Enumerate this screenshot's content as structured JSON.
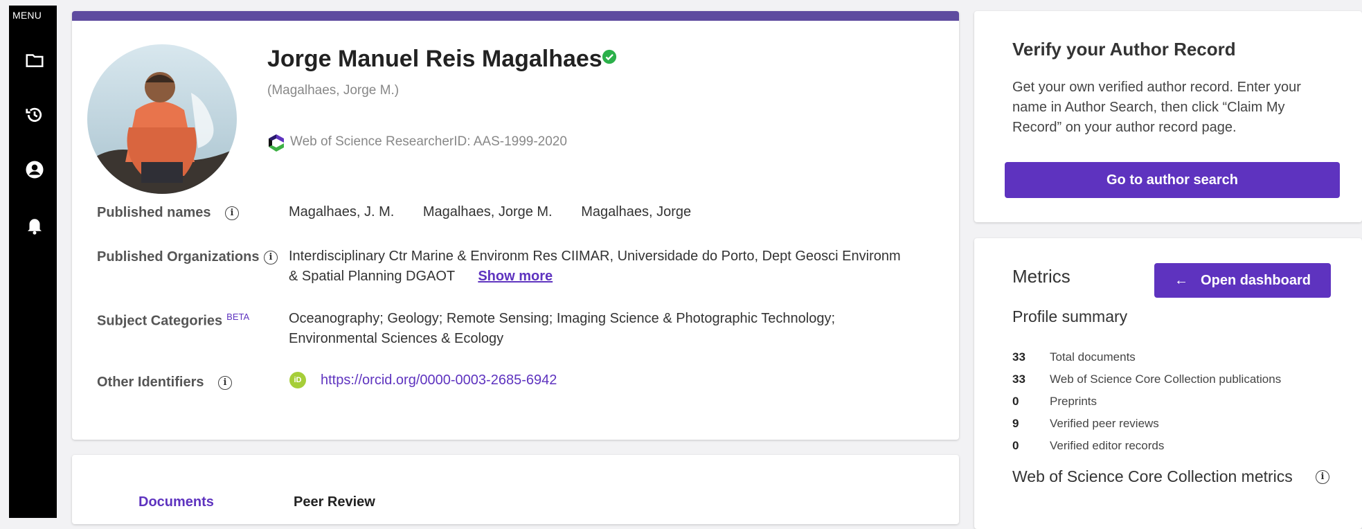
{
  "sidebar": {
    "menu_label": "MENU",
    "items": [
      {
        "icon": "folder-icon"
      },
      {
        "icon": "history-icon"
      },
      {
        "icon": "account-icon"
      },
      {
        "icon": "bell-icon"
      }
    ]
  },
  "profile": {
    "name": "Jorge Manuel Reis Magalhaes",
    "alt_name": "(Magalhaes, Jorge M.)",
    "researcher_id": "Web of Science ResearcherID: AAS-1999-2020",
    "published_names_label": "Published names",
    "published_names": [
      "Magalhaes, J. M.",
      "Magalhaes, Jorge M.",
      "Magalhaes, Jorge"
    ],
    "orgs_label": "Published Organizations",
    "orgs_line1": "Interdisciplinary Ctr Marine & Environm Res CIIMAR,  Universidade do Porto,  Dept Geosci Environm",
    "orgs_line2": "& Spatial Planning DGAOT",
    "show_more": "Show more",
    "subjects_label": "Subject Categories",
    "beta": "BETA",
    "subjects_line1": "Oceanography;  Geology;  Remote Sensing;  Imaging Science & Photographic Technology;",
    "subjects_line2": "Environmental Sciences & Ecology",
    "identifiers_label": "Other Identifiers",
    "orcid_url": "https://orcid.org/0000-0003-2685-6942",
    "orcid_icon_text": "iD"
  },
  "tabs": {
    "documents": "Documents",
    "peer_review": "Peer Review"
  },
  "verify": {
    "title": "Verify your Author Record",
    "text": "Get your own verified author record. Enter your name in Author Search, then click “Claim My Record” on your author record page.",
    "button": "Go to author search"
  },
  "metrics": {
    "title": "Metrics",
    "open_dashboard": "Open dashboard",
    "profile_summary": "Profile summary",
    "rows": [
      {
        "value": "33",
        "label": "Total documents"
      },
      {
        "value": "33",
        "label": "Web of Science Core Collection publications"
      },
      {
        "value": "0",
        "label": "Preprints"
      },
      {
        "value": "9",
        "label": "Verified peer reviews"
      },
      {
        "value": "0",
        "label": "Verified editor records"
      }
    ],
    "core_collection_metrics": "Web of Science Core Collection metrics"
  },
  "colors": {
    "accent": "#5e33bf",
    "header_bar": "#5e4b9f",
    "verified": "#2bb04a",
    "orcid": "#a6ce39"
  }
}
